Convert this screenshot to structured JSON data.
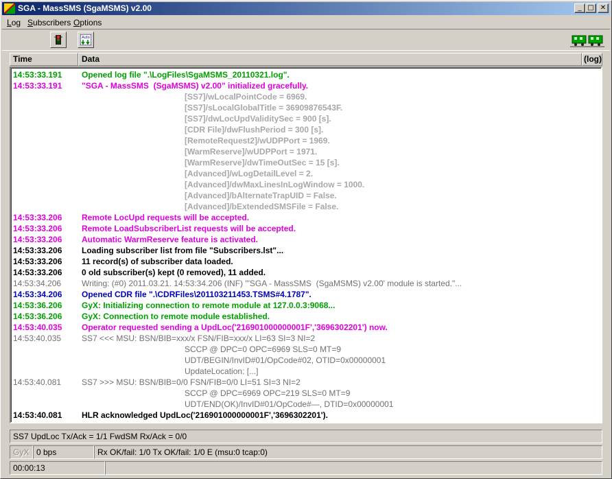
{
  "window": {
    "title": "SGA - MassSMS  (SgaMSMS) v2.00",
    "controls": {
      "minimize": "_",
      "maximize": "□",
      "close": "✕"
    }
  },
  "menu": [
    {
      "label": "Log",
      "accel": "L"
    },
    {
      "label": "Subscribers",
      "accel": "S"
    },
    {
      "label": "Options",
      "accel": "O"
    }
  ],
  "toolbar": {
    "buttons": [
      {
        "icon": "traffic-light-icon"
      },
      {
        "icon": "auto-reserve-icon",
        "text": "Auto"
      }
    ],
    "indicator": {
      "icon": "connection-trains-icon",
      "color": "#00a000"
    }
  },
  "header": {
    "time": "Time",
    "data": "Data",
    "tag": "(log)"
  },
  "colors": {
    "green": "#00a000",
    "magenta": "#e000e0",
    "grey": "#a8a8a8",
    "darkgrey": "#707070",
    "black": "#000000",
    "blue": "#0000c0"
  },
  "log": [
    {
      "time": "14:53:33.191",
      "msg": "Opened log file \".\\LogFiles\\SgaMSMS_20110321.log\".",
      "color": "green"
    },
    {
      "time": "14:53:33.191",
      "msg": "\"SGA - MassSMS  (SgaMSMS) v2.00\" initialized gracefully.",
      "color": "magenta"
    },
    {
      "time": "",
      "msg": "[SS7]/wLocalPointCode = 6969.",
      "color": "grey",
      "indent": true
    },
    {
      "time": "",
      "msg": "[SS7]/sLocalGlobalTitle = 36909876543F.",
      "color": "grey",
      "indent": true
    },
    {
      "time": "",
      "msg": "[SS7]/dwLocUpdValiditySec = 900 [s].",
      "color": "grey",
      "indent": true
    },
    {
      "time": "",
      "msg": "[CDR File]/dwFlushPeriod = 300 [s].",
      "color": "grey",
      "indent": true
    },
    {
      "time": "",
      "msg": "[RemoteRequest2]/wUDPPort = 1969.",
      "color": "grey",
      "indent": true
    },
    {
      "time": "",
      "msg": "[WarmReserve]/wUDPPort = 1971.",
      "color": "grey",
      "indent": true
    },
    {
      "time": "",
      "msg": "[WarmReserve]/dwTimeOutSec = 15 [s].",
      "color": "grey",
      "indent": true
    },
    {
      "time": "",
      "msg": "[Advanced]/wLogDetailLevel = 2.",
      "color": "grey",
      "indent": true
    },
    {
      "time": "",
      "msg": "[Advanced]/dwMaxLinesInLogWindow = 1000.",
      "color": "grey",
      "indent": true
    },
    {
      "time": "",
      "msg": "[Advanced]/bAlternateTrapUID = False.",
      "color": "grey",
      "indent": true
    },
    {
      "time": "",
      "msg": "[Advanced]/bExtendedSMSFile = False.",
      "color": "grey",
      "indent": true
    },
    {
      "time": "14:53:33.206",
      "msg": "Remote LocUpd requests will be accepted.",
      "color": "magenta"
    },
    {
      "time": "14:53:33.206",
      "msg": "Remote LoadSubscriberList requests will be accepted.",
      "color": "magenta"
    },
    {
      "time": "14:53:33.206",
      "msg": "Automatic WarmReserve feature is activated.",
      "color": "magenta"
    },
    {
      "time": "14:53:33.206",
      "msg": "Loading subscriber list from file \"Subscribers.lst\"...",
      "color": "black"
    },
    {
      "time": "14:53:33.206",
      "msg": "11 record(s) of subscriber data loaded.",
      "color": "black"
    },
    {
      "time": "14:53:33.206",
      "msg": "0 old subscriber(s) kept (0 removed), 11 added.",
      "color": "black"
    },
    {
      "time": "14:53:34.206",
      "msg": "Writing: (#0) 2011.03.21. 14:53:34.206 (INF) '\"SGA - MassSMS  (SgaMSMS) v2.00' module is started.\"...",
      "color": "darkgrey",
      "normal": true
    },
    {
      "time": "14:53:34.206",
      "msg": "Opened CDR file \".\\CDRFiles\\201103211453.TSMS#4.1787\".",
      "color": "blue"
    },
    {
      "time": "14:53:36.206",
      "msg": "GyX: Initializing connection to remote module at 127.0.0.3:9068...",
      "color": "green"
    },
    {
      "time": "14:53:36.206",
      "msg": "GyX: Connection to remote module established.",
      "color": "green"
    },
    {
      "time": "14:53:40.035",
      "msg": "Operator requested sending a UpdLoc('216901000000001F','3696302201') now.",
      "color": "magenta"
    },
    {
      "time": "14:53:40.035",
      "msg": "SS7 <<< MSU: BSN/BIB=xxx/x FSN/FIB=xxx/x LI=63 SI=3 NI=2",
      "color": "darkgrey",
      "normal": true
    },
    {
      "time": "",
      "msg": "SCCP @ DPC=0 OPC=6969 SLS=0 MT=9",
      "color": "darkgrey",
      "indent": true,
      "normal": true
    },
    {
      "time": "",
      "msg": "UDT/BEGIN/InvID#01/OpCode#02, OTID=0x00000001",
      "color": "darkgrey",
      "indent": true,
      "normal": true
    },
    {
      "time": "",
      "msg": "UpdateLocation: [...]",
      "color": "darkgrey",
      "indent": true,
      "normal": true
    },
    {
      "time": "14:53:40.081",
      "msg": "SS7 >>> MSU: BSN/BIB=0/0 FSN/FIB=0/0 LI=51 SI=3 NI=2",
      "color": "darkgrey",
      "normal": true
    },
    {
      "time": "",
      "msg": "SCCP @ DPC=6969 OPC=219 SLS=0 MT=9",
      "color": "darkgrey",
      "indent": true,
      "normal": true
    },
    {
      "time": "",
      "msg": "UDT/END(OK)/InvID#01/OpCode#—, DTID=0x00000001",
      "color": "darkgrey",
      "indent": true,
      "normal": true
    },
    {
      "time": "14:53:40.081",
      "msg": "HLR acknowledged UpdLoc('216901000000001F','3696302201').",
      "color": "black"
    }
  ],
  "status": {
    "ss7": "SS7    UpdLoc Tx/Ack = 1/1    FwdSM Rx/Ack = 0/0",
    "gyx_label": "GyX",
    "gyx_rate": "0 bps",
    "gyx_stats": "Rx OK/fail: 1/0    Tx OK/fail: 1/0    E (msu:0  tcap:0)",
    "elapsed": "00:00:13",
    "message": ""
  }
}
